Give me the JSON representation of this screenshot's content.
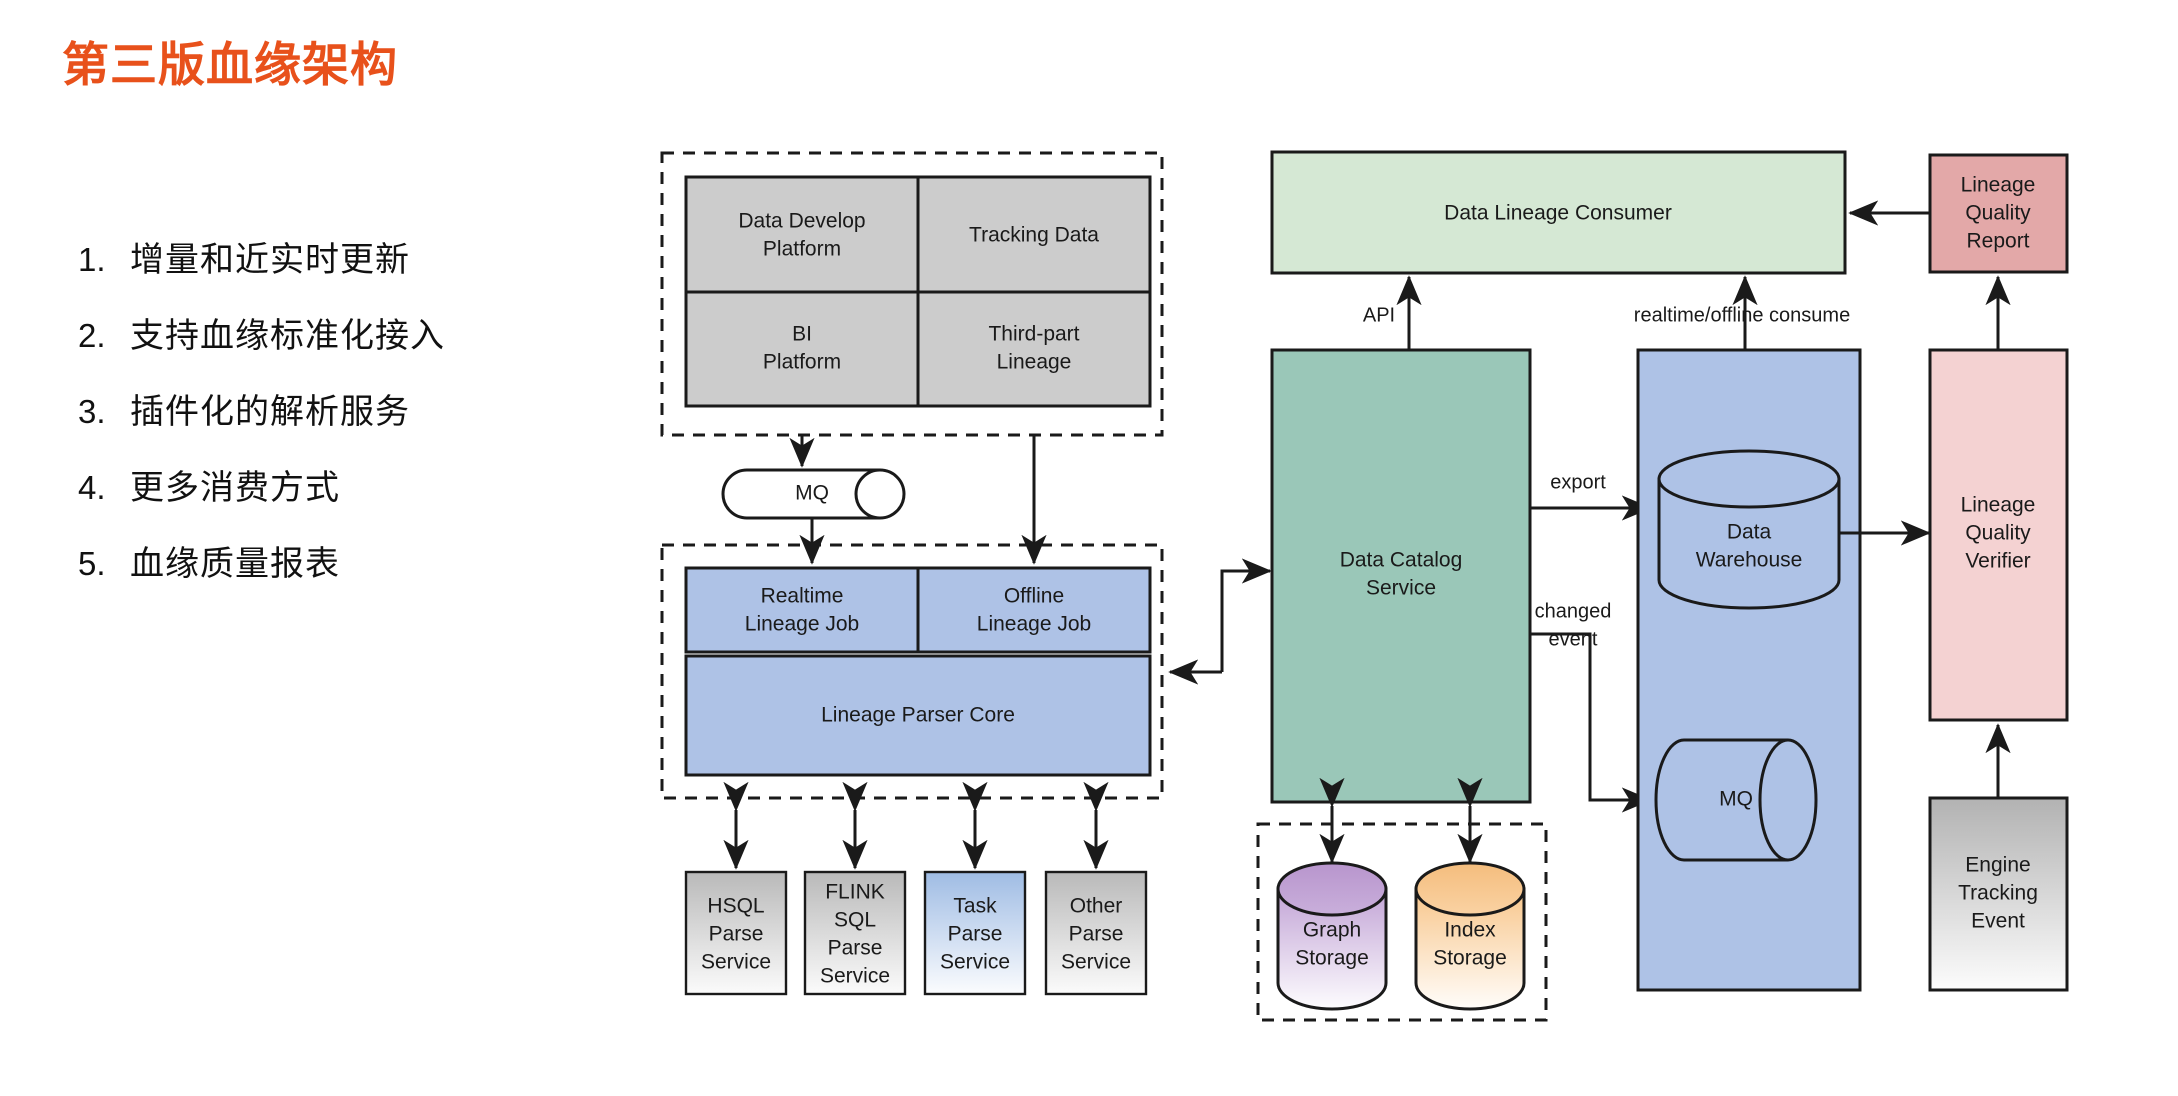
{
  "slide": {
    "title": "第三版血缘架构",
    "title_color": "#e8511b",
    "bullets": [
      {
        "num": "1.",
        "text": "增量和近实时更新"
      },
      {
        "num": "2.",
        "text": "支持血缘标准化接入"
      },
      {
        "num": "3.",
        "text": "插件化的解析服务"
      },
      {
        "num": "4.",
        "text": "更多消费方式"
      },
      {
        "num": "5.",
        "text": "血缘质量报表"
      }
    ]
  },
  "diagram": {
    "sources": {
      "data_develop_platform": "Data Develop\nPlatform",
      "data_develop_platform_l1": "Data Develop",
      "data_develop_platform_l2": "Platform",
      "tracking_data": "Tracking Data",
      "bi_platform_l1": "BI",
      "bi_platform_l2": "Platform",
      "third_part_lineage_l1": "Third-part",
      "third_part_lineage_l2": "Lineage",
      "fill": "#cccccc"
    },
    "mq_queue": {
      "label": "MQ",
      "fill": "#ffffff"
    },
    "lineage_jobs": {
      "realtime_l1": "Realtime",
      "realtime_l2": "Lineage Job",
      "offline_l1": "Offline",
      "offline_l2": "Lineage Job",
      "parser_core": "Lineage Parser Core",
      "fill": "#aec2e6"
    },
    "parse_services": [
      {
        "lines": [
          "HSQL",
          "Parse",
          "Service"
        ],
        "fill": "grey-gradient"
      },
      {
        "lines": [
          "FLINK",
          "SQL",
          "Parse",
          "Service"
        ],
        "fill": "grey-gradient"
      },
      {
        "lines": [
          "Task",
          "Parse",
          "Service"
        ],
        "fill": "blue-gradient"
      },
      {
        "lines": [
          "Other",
          "Parse",
          "Service"
        ],
        "fill": "grey-gradient"
      }
    ],
    "consumer": {
      "label": "Data Lineage Consumer",
      "fill": "#d5e8d4"
    },
    "catalog_service": {
      "l1": "Data Catalog",
      "l2": "Service",
      "fill": "#9ac7b8"
    },
    "storages": [
      {
        "l1": "Graph",
        "l2": "Storage",
        "fill_top": "#c5a8d6",
        "fill_bottom": "#ffffff"
      },
      {
        "l1": "Index",
        "l2": "Storage",
        "fill_top": "#f8c990",
        "fill_bottom": "#ffffff"
      }
    ],
    "warehouse_panel": {
      "fill": "#aec2e6"
    },
    "data_warehouse": {
      "l1": "Data",
      "l2": "Warehouse",
      "fill": "#aec2e6"
    },
    "mq_cylinder": {
      "label": "MQ",
      "fill": "#aec2e6"
    },
    "quality_report": {
      "l1": "Lineage",
      "l2": "Quality",
      "l3": "Report",
      "fill": "#e3a8a8"
    },
    "quality_verifier": {
      "l1": "Lineage",
      "l2": "Quality",
      "l3": "Verifier",
      "fill": "#f4d2d2"
    },
    "engine_tracking_event": {
      "l1": "Engine",
      "l2": "Tracking",
      "l3": "Event",
      "fill_top": "#b3b3b3",
      "fill_bottom": "#fcfcfc"
    },
    "edge_labels": {
      "api": "API",
      "consume": "realtime/offline consume",
      "export": "export",
      "changed_event_l1": "changed",
      "changed_event_l2": "event"
    }
  }
}
